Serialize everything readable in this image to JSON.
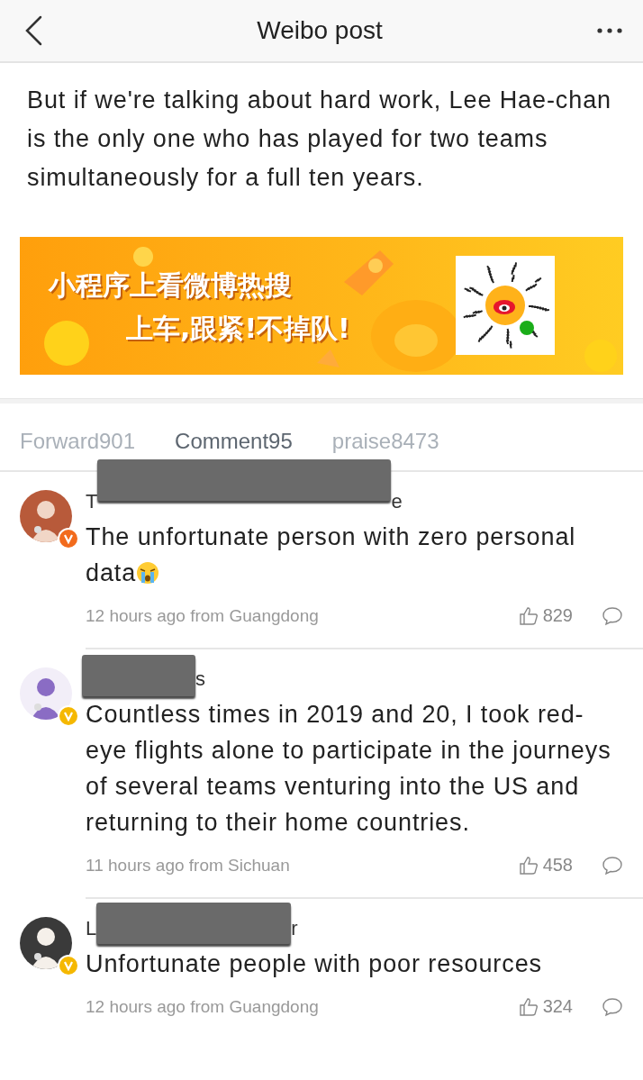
{
  "header": {
    "title": "Weibo post"
  },
  "post": {
    "text": "But if we're talking about hard work, Lee Hae-chan is the only one who has played for two teams simultaneously for a full ten years."
  },
  "banner": {
    "lines": [
      "小程序上看微博热搜",
      "上车,跟紧!不掉队!"
    ]
  },
  "tabs": [
    {
      "label": "Forward901",
      "selected": false
    },
    {
      "label": "Comment95",
      "selected": true
    },
    {
      "label": "praise8473",
      "selected": false
    }
  ],
  "comments": [
    {
      "name_start": "T",
      "name_end": "e",
      "color": "#f26b1d",
      "text": "The unfortunate person with zero personal data",
      "has_emoji": true,
      "meta": "12 hours ago from Guangdong",
      "likes": "829"
    },
    {
      "name_end": "s",
      "color": "#f5b800",
      "text": "Countless times in 2019 and 20, I took red-eye flights alone to participate in the journeys of several teams venturing into the US and returning to their home countries.",
      "has_emoji": false,
      "meta": "11 hours ago from Sichuan",
      "likes": "458"
    },
    {
      "name_start": "L",
      "name_end": "r",
      "color": "#f5b800",
      "text": "Unfortunate people with poor resources",
      "has_emoji": false,
      "meta": "12 hours ago from Guangdong",
      "likes": "324"
    }
  ]
}
